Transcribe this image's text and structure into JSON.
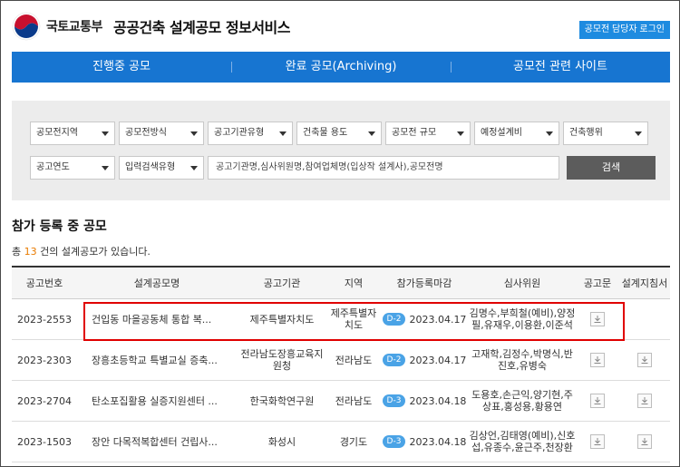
{
  "header": {
    "ministry": "국토교통부",
    "service_title": "공공건축 설계공모 정보서비스",
    "login_label": "공모전 담당자 로그인"
  },
  "nav": {
    "items": [
      "진행중 공모",
      "완료 공모(Archiving)",
      "공모전 관련 사이트"
    ]
  },
  "search": {
    "row1": [
      "공모전지역",
      "공모전방식",
      "공고기관유형",
      "건축물 용도",
      "공모전 규모",
      "예정설계비",
      "건축행위"
    ],
    "row2": [
      "공고연도",
      "입력검색유형"
    ],
    "input_placeholder": "공고기관명,심사위원명,참여업체명(입상작 설계사),공모전명",
    "search_label": "검색"
  },
  "section": {
    "title": "참가 등록 중 공모",
    "count_prefix": "총 ",
    "count_num": "13",
    "count_suffix": " 건의 설계공모가 있습니다."
  },
  "table": {
    "headers": [
      "공고번호",
      "설계공모명",
      "공고기관",
      "지역",
      "참가등록마감",
      "심사위원",
      "공고문",
      "설계지침서"
    ],
    "rows": [
      {
        "id": "2023-2553",
        "name": "건입동 마을공동체 통합 복...",
        "agency": "제주특별자치도",
        "region": "제주특별자치도",
        "dday": "D-2",
        "deadline": "2023.04.17",
        "judges": "김명수,부희철(예비),양정필,유재우,이용환,이준석"
      },
      {
        "id": "2023-2303",
        "name": "장흥초등학교 특별교실 증축...",
        "agency": "전라남도장흥교육지원청",
        "region": "전라남도",
        "dday": "D-2",
        "deadline": "2023.04.17",
        "judges": "고재학,김정수,박명식,반진호,유병숙"
      },
      {
        "id": "2023-2704",
        "name": "탄소포집활용 실증지원센터 ...",
        "agency": "한국화학연구원",
        "region": "전라남도",
        "dday": "D-3",
        "deadline": "2023.04.18",
        "judges": "도용호,손근익,양기현,주상표,홍성용,황용연"
      },
      {
        "id": "2023-1503",
        "name": "장안 다목적복합센터 건립사...",
        "agency": "화성시",
        "region": "경기도",
        "dday": "D-3",
        "deadline": "2023.04.18",
        "judges": "김상언,김태영(예비),신호섭,유종수,윤근주,천장환"
      }
    ]
  },
  "colors": {
    "nav_blue": "#1775d1",
    "login_blue": "#1e8be0",
    "dday_blue": "#4aa3e6",
    "count_orange": "#e87b00",
    "highlight_red": "#e00000"
  },
  "icons": [
    "ministry-logo",
    "chevron-down-icon",
    "download-icon"
  ]
}
